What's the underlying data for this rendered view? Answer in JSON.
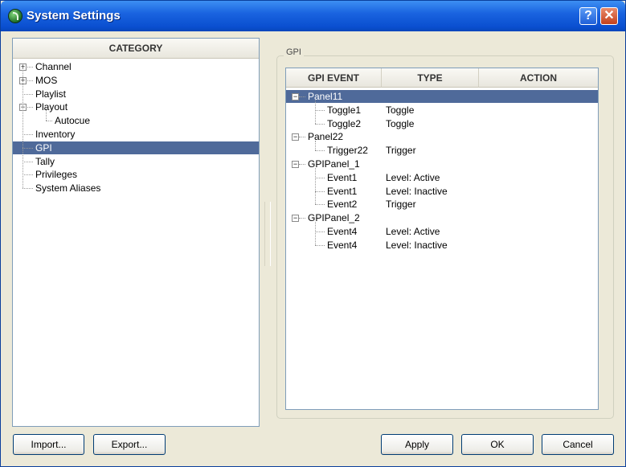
{
  "window": {
    "title": "System Settings",
    "help_label": "?",
    "close_label": "✕",
    "icon": "app-icon"
  },
  "category": {
    "header": "CATEGORY",
    "items": [
      {
        "label": "Channel",
        "expandable": true,
        "expanded": false,
        "selected": false
      },
      {
        "label": "MOS",
        "expandable": true,
        "expanded": false,
        "selected": false
      },
      {
        "label": "Playlist",
        "expandable": false,
        "selected": false
      },
      {
        "label": "Playout",
        "expandable": true,
        "expanded": true,
        "selected": false
      },
      {
        "label": "Autocue",
        "expandable": false,
        "selected": false,
        "level": 2
      },
      {
        "label": "Inventory",
        "expandable": false,
        "selected": false
      },
      {
        "label": "GPI",
        "expandable": false,
        "selected": true
      },
      {
        "label": "Tally",
        "expandable": false,
        "selected": false
      },
      {
        "label": "Privileges",
        "expandable": false,
        "selected": false
      },
      {
        "label": "System Aliases",
        "expandable": false,
        "selected": false
      }
    ]
  },
  "gpi": {
    "group_label": "GPI",
    "columns": [
      "GPI EVENT",
      "TYPE",
      "ACTION"
    ],
    "panels": [
      {
        "name": "Panel11",
        "selected": true,
        "events": [
          {
            "event": "Toggle1",
            "type": "Toggle",
            "action": ""
          },
          {
            "event": "Toggle2",
            "type": "Toggle",
            "action": ""
          }
        ]
      },
      {
        "name": "Panel22",
        "selected": false,
        "events": [
          {
            "event": "Trigger22",
            "type": "Trigger",
            "action": ""
          }
        ]
      },
      {
        "name": "GPIPanel_1",
        "selected": false,
        "events": [
          {
            "event": "Event1",
            "type": "Level: Active",
            "action": ""
          },
          {
            "event": "Event1",
            "type": "Level: Inactive",
            "action": ""
          },
          {
            "event": "Event2",
            "type": "Trigger",
            "action": ""
          }
        ]
      },
      {
        "name": "GPIPanel_2",
        "selected": false,
        "events": [
          {
            "event": "Event4",
            "type": "Level: Active",
            "action": ""
          },
          {
            "event": "Event4",
            "type": "Level: Inactive",
            "action": ""
          }
        ]
      }
    ]
  },
  "buttons": {
    "import": "Import...",
    "export": "Export...",
    "apply": "Apply",
    "ok": "OK",
    "cancel": "Cancel"
  },
  "colors": {
    "title_bar": "#0a4fd0",
    "selection": "#4f6a9a",
    "dialog_bg": "#ece9d8"
  }
}
